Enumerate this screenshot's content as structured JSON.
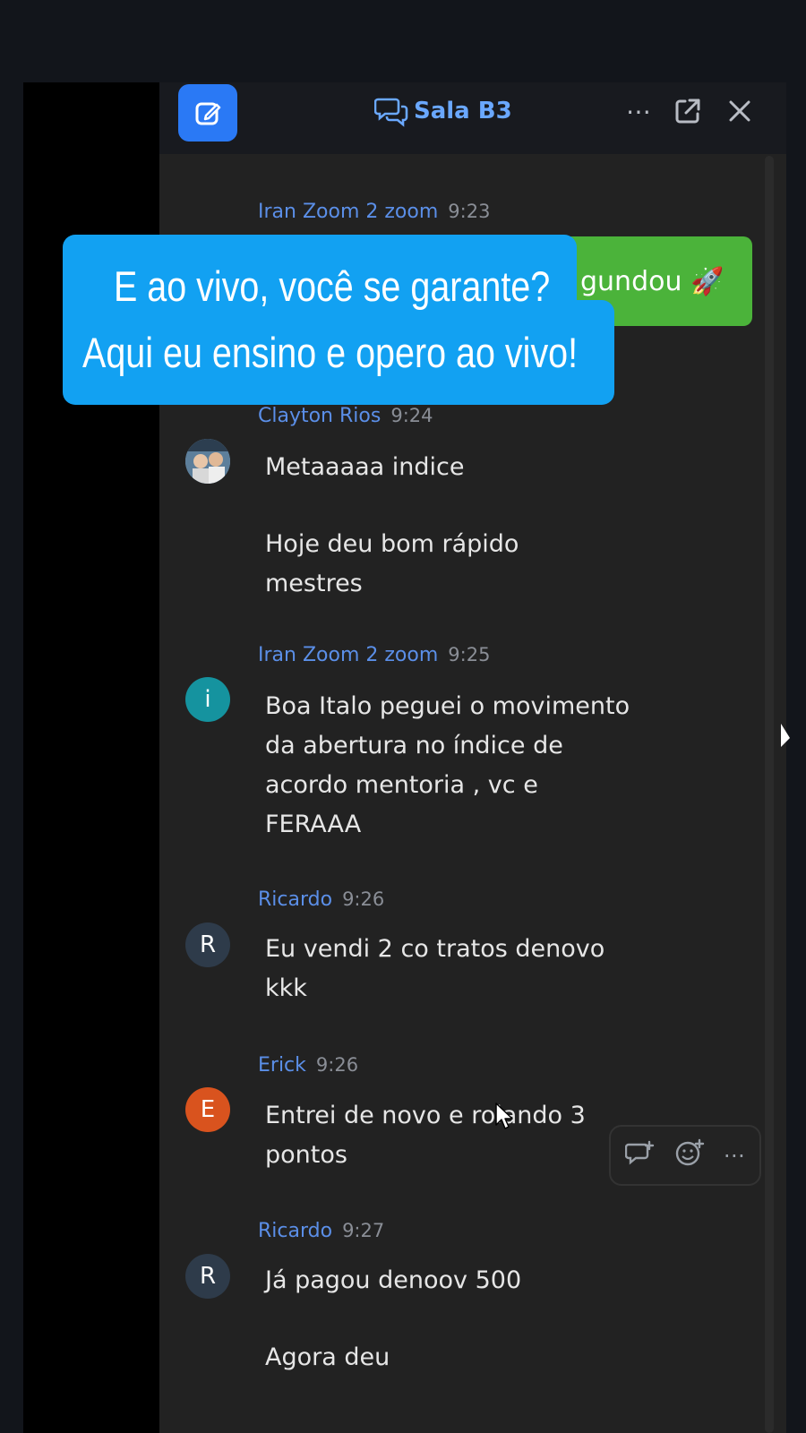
{
  "window": {
    "title": "Sala B3",
    "title_icon": "chat-bubbles-icon",
    "compose_icon": "compose-icon",
    "more_icon": "more-icon",
    "popout_icon": "popout-icon",
    "close_icon": "close-icon"
  },
  "overlay": {
    "line1": "E ao vivo, você se garante?",
    "line2": "Aqui eu ensino e opero ao vivo!"
  },
  "messages": [
    {
      "sender": "Iran Zoom 2 zoom",
      "time": "9:23",
      "bubble": "gundou 🚀"
    },
    {
      "sender": "Clayton Rios",
      "time": "9:24",
      "avatar": "photo",
      "lines": [
        "Metaaaaa indice",
        "Hoje deu bom rápido mestres"
      ]
    },
    {
      "sender": "Iran Zoom 2 zoom",
      "time": "9:25",
      "avatar": "i",
      "avatar_color": "#15939f",
      "lines": [
        "Boa Italo peguei o movimento da abertura no índice de acordo mentoria , vc e FERAAA"
      ]
    },
    {
      "sender": "Ricardo",
      "time": "9:26",
      "avatar": "R",
      "avatar_color": "#2e3b4a",
      "lines": [
        "Eu vendi 2 co tratos denovo kkk"
      ]
    },
    {
      "sender": "Erick",
      "time": "9:26",
      "avatar": "E",
      "avatar_color": "#d9531e",
      "lines": [
        "Entrei de novo e rolando 3",
        "pontos"
      ]
    },
    {
      "sender": "Ricardo",
      "time": "9:27",
      "avatar": "R",
      "avatar_color": "#2e3b4a",
      "lines": [
        "Já pagou denoov 500",
        "Agora deu"
      ]
    }
  ],
  "hover_actions": {
    "reply_icon": "reply-in-thread-icon",
    "emoji_icon": "add-reaction-icon",
    "more_icon": "more-options-icon"
  }
}
